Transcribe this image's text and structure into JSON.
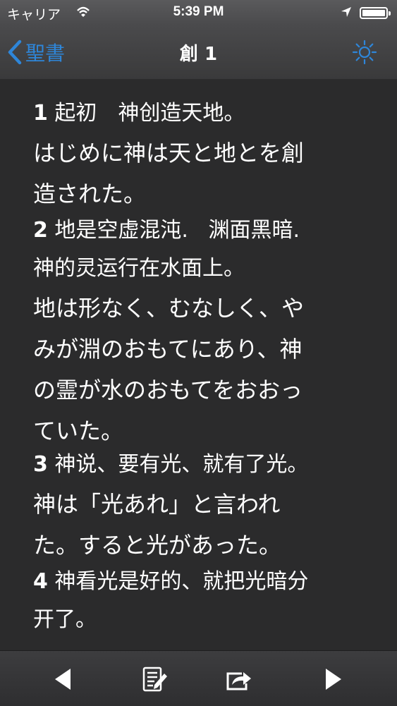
{
  "status_bar": {
    "carrier": "キャリア",
    "time": "5:39 PM"
  },
  "nav": {
    "back_label": "聖書",
    "title": "創 1"
  },
  "verses": [
    {
      "number": "1",
      "zh_lines": [
        " 起初　神创造天地。"
      ],
      "ja_lines": [
        "はじめに神は天と地とを創",
        "造された。"
      ]
    },
    {
      "number": "2",
      "zh_lines": [
        " 地是空虚混沌.   渊面黑暗.",
        "神的灵运行在水面上。"
      ],
      "ja_lines": [
        "地は形なく、むなしく、や",
        "みが淵のおもてにあり、神",
        "の霊が水のおもてをおおっ",
        "ていた。"
      ]
    },
    {
      "number": "3",
      "zh_lines": [
        " 神说、要有光、就有了光。"
      ],
      "ja_lines": [
        "神は「光あれ」と言われ",
        "た。すると光があった。"
      ]
    },
    {
      "number": "4",
      "zh_lines": [
        " 神看光是好的、就把光暗分",
        "开了。"
      ],
      "ja_lines": []
    }
  ],
  "colors": {
    "accent": "#2e86d9",
    "background": "#2b2b2c"
  },
  "toolbar": {
    "icons": [
      "prev-chapter-icon",
      "notes-icon",
      "share-icon",
      "next-chapter-icon"
    ]
  }
}
